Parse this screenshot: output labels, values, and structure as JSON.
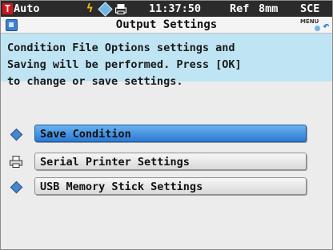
{
  "status_bar": {
    "mode_icon": "T",
    "mode_label": "Auto",
    "icons": [
      "flash-icon",
      "probe-icon",
      "printer-icon"
    ],
    "flash_glyph": "ϟ",
    "clock": "11:37:50",
    "ref": "Ref",
    "aperture": "8mm",
    "sce": "SCE"
  },
  "title_bar": {
    "title": "Output Settings",
    "menu_label": "MENU",
    "menu_arrow": "↶"
  },
  "instruction": "Condition File Options settings and\nSaving will be performed. Press [OK]\nto change or save settings.",
  "menu": {
    "items": [
      {
        "label": "Save Condition",
        "icon": "diamond-icon",
        "selected": true
      },
      {
        "label": "Serial Printer Settings",
        "icon": "printer-icon",
        "selected": false
      },
      {
        "label": "USB Memory Stick Settings",
        "icon": "diamond-icon",
        "selected": false
      }
    ]
  },
  "colors": {
    "status_bg": "#2b2b2b",
    "instruction_bg": "#bfe4f3",
    "selected": "#2b79d4",
    "mode_icon": "#d1151b",
    "flash": "#f0b21a"
  }
}
